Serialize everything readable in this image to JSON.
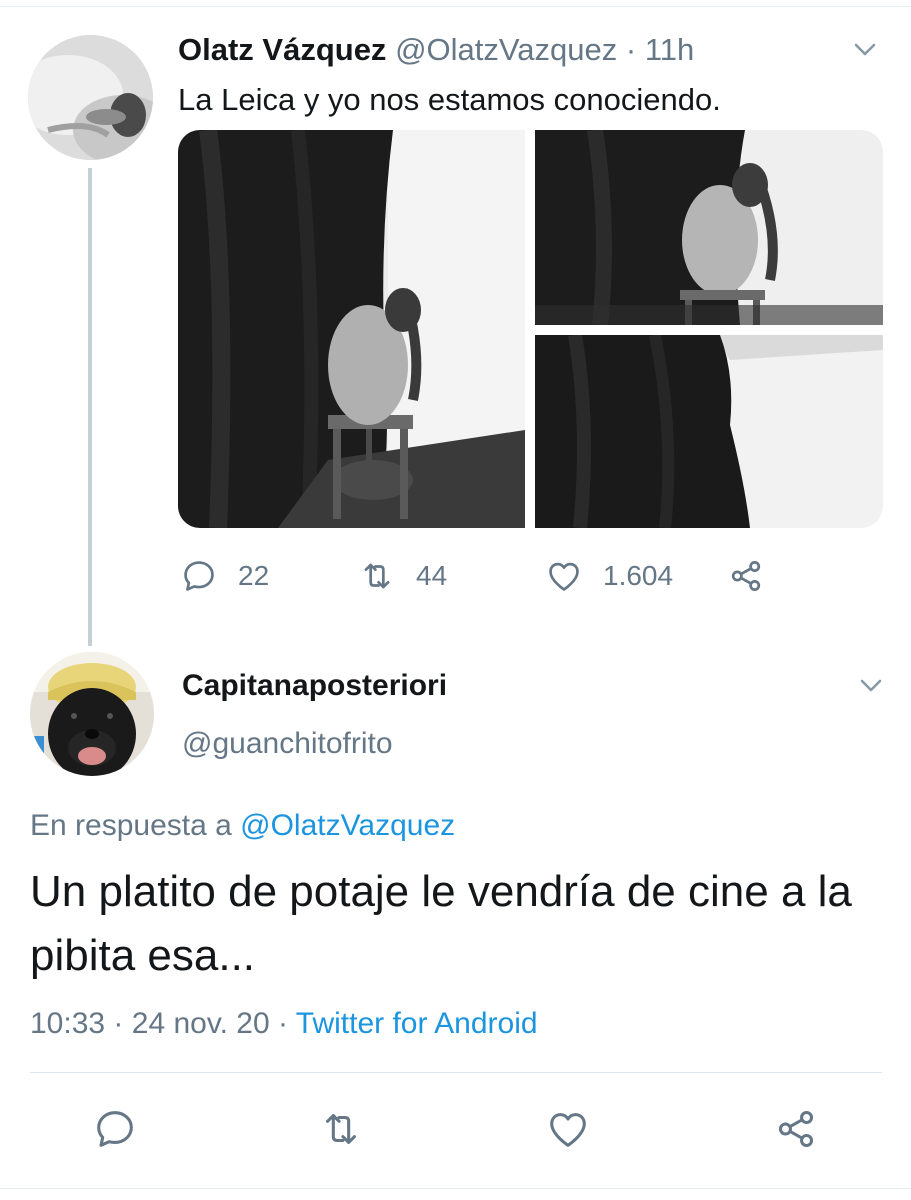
{
  "parent_tweet": {
    "display_name": "Olatz Vázquez",
    "handle": "@OlatzVazquez",
    "separator": "·",
    "time": "11h",
    "text": "La Leica y yo nos estamos conociendo.",
    "avatar_icon": "user-avatar-photo",
    "media_photos": [
      "photo-seated-figure",
      "photo-seated-figure-closeup",
      "photo-curtain-corner"
    ],
    "actions": {
      "reply_count": "22",
      "retweet_count": "44",
      "like_count": "1.604"
    }
  },
  "reply_tweet": {
    "display_name": "Capitanaposteriori",
    "handle": "@guanchitofrito",
    "in_reply_prefix": "En respuesta a",
    "in_reply_handle": "@OlatzVazquez",
    "text": "Un platito de potaje le vendría de cine a la pibita esa...",
    "time": "10:33",
    "date": "24 nov. 20",
    "source": "Twitter for Android",
    "meta_separator": "·"
  },
  "colors": {
    "text_primary": "#14171a",
    "text_muted": "#657786",
    "link": "#1b95e0",
    "thread_line": "#c4cfd6",
    "divider": "#e1e8ed"
  }
}
